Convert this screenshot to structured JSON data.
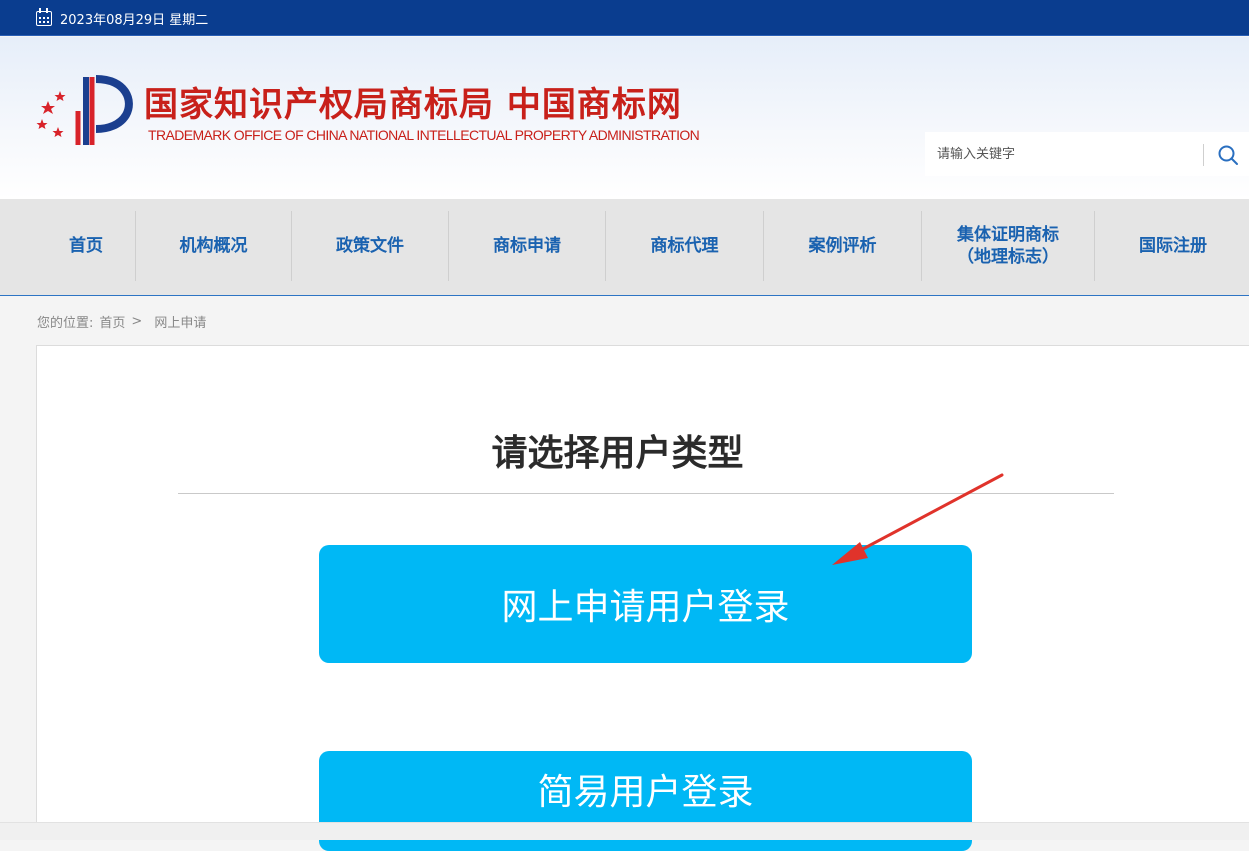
{
  "topbar": {
    "date": "2023年08月29日  星期二",
    "calendar_icon": "calendar-icon"
  },
  "header": {
    "logo_cn": "国家知识产权局商标局 中国商标网",
    "logo_en": "TRADEMARK OFFICE OF CHINA NATIONAL INTELLECTUAL PROPERTY ADMINISTRATION",
    "search_placeholder": "请输入关键字",
    "search_icon": "search-icon"
  },
  "nav": {
    "items": [
      {
        "label": "首页"
      },
      {
        "label": "机构概况"
      },
      {
        "label": "政策文件"
      },
      {
        "label": "商标申请"
      },
      {
        "label": "商标代理"
      },
      {
        "label": "案例评析"
      },
      {
        "label": "集体证明商标\n（地理标志）"
      },
      {
        "label": "国际注册"
      }
    ]
  },
  "breadcrumb": {
    "prefix": "您的位置:",
    "home": "首页",
    "separator": ">",
    "current": "网上申请"
  },
  "main": {
    "title": "请选择用户类型",
    "online_login": "网上申请用户登录",
    "simple_login": "简易用户登录"
  },
  "colors": {
    "topbar": "#0a3d8f",
    "nav_text": "#1a62b0",
    "button": "#00b8f5",
    "logo_red": "#c8201a",
    "annotation_arrow": "#e0332b"
  }
}
